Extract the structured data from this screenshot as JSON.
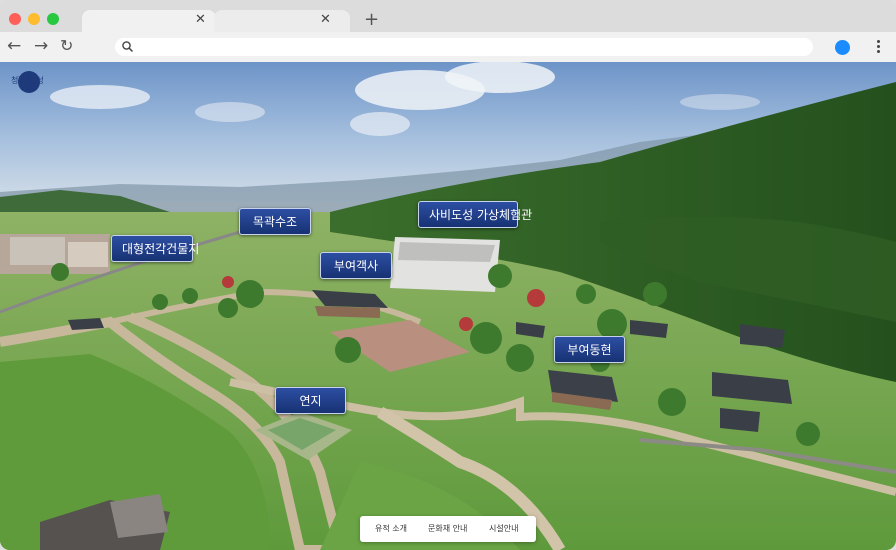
{
  "browser": {
    "tabs": [
      {
        "label": "",
        "close": "✕"
      },
      {
        "label": "",
        "close": "✕"
      }
    ],
    "new_tab": "+",
    "back": "←",
    "forward": "→",
    "reload": "↻",
    "url": "",
    "accent": "#1a8cff"
  },
  "site": {
    "logo_text": "청풍나루성"
  },
  "map_labels": [
    {
      "id": "mokgwak",
      "label": "목곽수조"
    },
    {
      "id": "sabi",
      "label": "사비도성 가상체험관"
    },
    {
      "id": "daehyeong",
      "label": "대형전각건물지"
    },
    {
      "id": "buyeo-gaeksa",
      "label": "부여객사"
    },
    {
      "id": "buyeo-donghyeon",
      "label": "부여동현"
    },
    {
      "id": "yeonji",
      "label": "연지"
    }
  ],
  "bottom_nav": {
    "items": [
      "유적 소개",
      "문화재 안내",
      "시설안내"
    ]
  }
}
